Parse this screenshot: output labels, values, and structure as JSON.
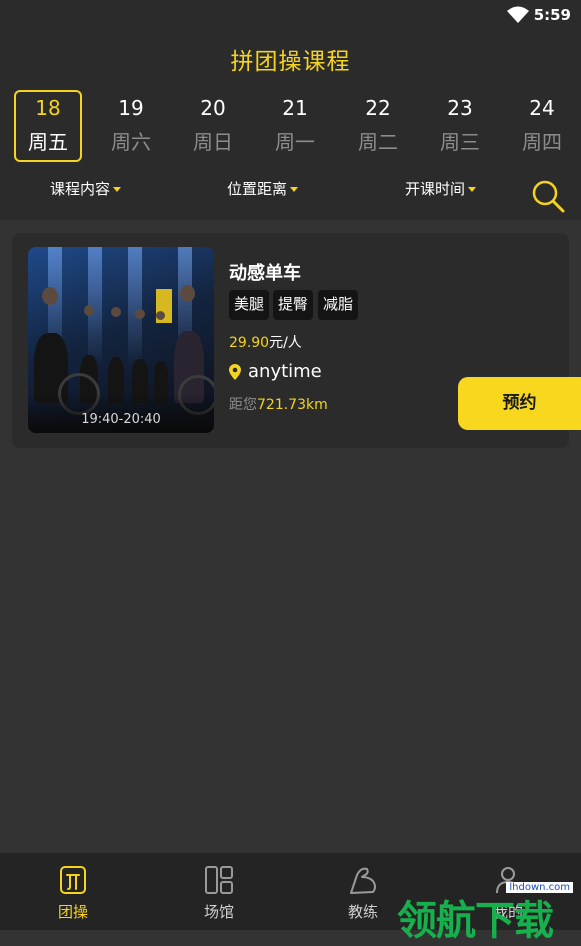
{
  "status_bar": {
    "time": "5:59"
  },
  "header": {
    "title": "拼团操课程"
  },
  "days": [
    {
      "num": "18",
      "weekday": "周五",
      "active": true
    },
    {
      "num": "19",
      "weekday": "周六"
    },
    {
      "num": "20",
      "weekday": "周日"
    },
    {
      "num": "21",
      "weekday": "周一"
    },
    {
      "num": "22",
      "weekday": "周二"
    },
    {
      "num": "23",
      "weekday": "周三"
    },
    {
      "num": "24",
      "weekday": "周四"
    }
  ],
  "filters": {
    "content": "课程内容",
    "distance": "位置距离",
    "time": "开课时间"
  },
  "card": {
    "time_slot": "19:40-20:40",
    "course_name": "动感单车",
    "tags": [
      "美腿",
      "提臀",
      "减脂"
    ],
    "price_value": "29.90",
    "price_unit": "元/人",
    "venue": "anytime",
    "distance_prefix": "距您",
    "distance_value": "721.73km",
    "book_label": "预约"
  },
  "tabbar": {
    "items": [
      {
        "label": "团操",
        "icon": "group-class-icon",
        "active": true
      },
      {
        "label": "场馆",
        "icon": "venue-icon"
      },
      {
        "label": "教练",
        "icon": "coach-icon"
      },
      {
        "label": "我的",
        "icon": "profile-icon"
      }
    ]
  },
  "watermark": {
    "url": "lhdown.com",
    "text": "领航下载"
  },
  "colors": {
    "accent": "#f5d320",
    "background": "#333333",
    "panel": "#2b2b2b"
  }
}
